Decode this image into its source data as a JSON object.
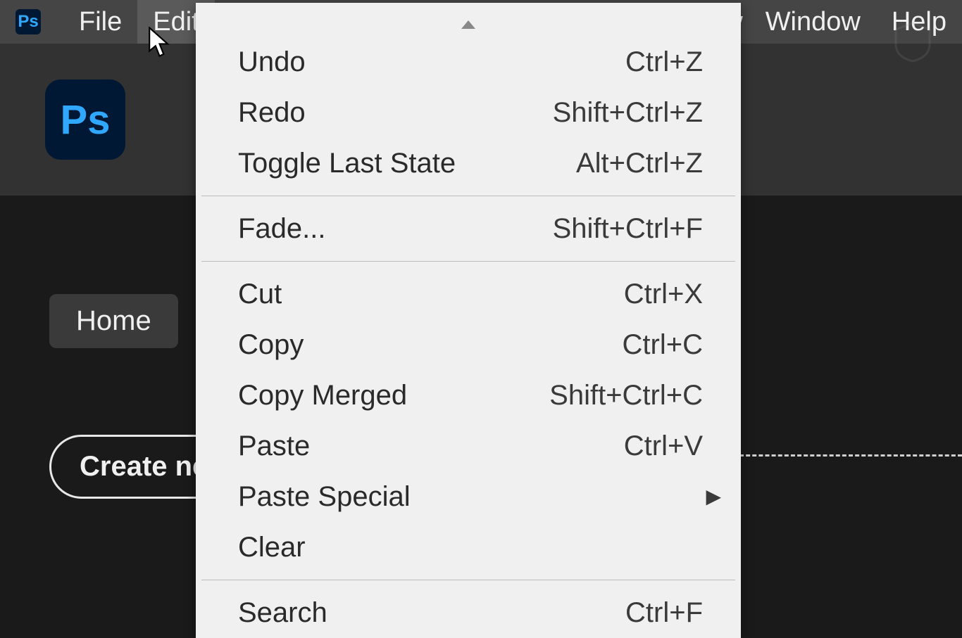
{
  "app": {
    "short": "Ps"
  },
  "menubar": {
    "left": [
      "File",
      "Edit"
    ],
    "right_partial_w": "w",
    "right": [
      "Window",
      "Help"
    ]
  },
  "sidebar": {
    "home": "Home",
    "create": "Create ne"
  },
  "edit_menu": {
    "groups": [
      [
        {
          "label": "Undo",
          "shortcut": "Ctrl+Z"
        },
        {
          "label": "Redo",
          "shortcut": "Shift+Ctrl+Z"
        },
        {
          "label": "Toggle Last State",
          "shortcut": "Alt+Ctrl+Z"
        }
      ],
      [
        {
          "label": "Fade...",
          "shortcut": "Shift+Ctrl+F"
        }
      ],
      [
        {
          "label": "Cut",
          "shortcut": "Ctrl+X"
        },
        {
          "label": "Copy",
          "shortcut": "Ctrl+C"
        },
        {
          "label": "Copy Merged",
          "shortcut": "Shift+Ctrl+C"
        },
        {
          "label": "Paste",
          "shortcut": "Ctrl+V"
        },
        {
          "label": "Paste Special",
          "shortcut": "",
          "submenu": true
        },
        {
          "label": "Clear",
          "shortcut": ""
        }
      ],
      [
        {
          "label": "Search",
          "shortcut": "Ctrl+F"
        }
      ]
    ]
  }
}
